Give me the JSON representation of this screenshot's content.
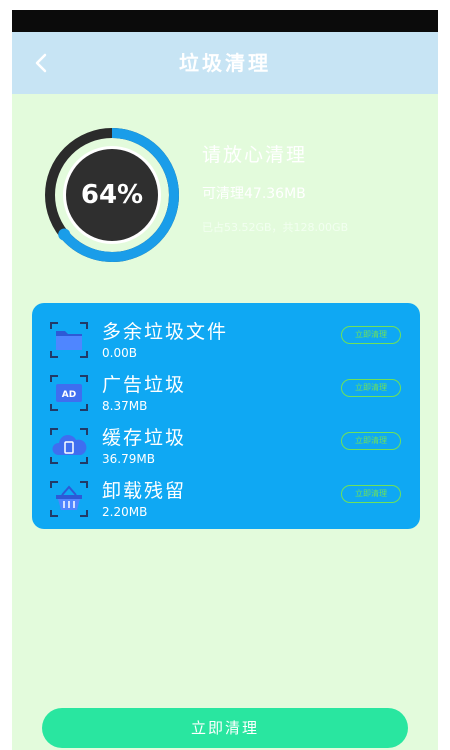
{
  "header": {
    "title": "垃圾清理",
    "back_icon": "chevron-left-icon"
  },
  "progress": {
    "percent_label": "64%",
    "value": 0.64,
    "ring_color": "#1a9de9",
    "core_color": "#2f2f2f"
  },
  "summary": {
    "headline": "请放心清理",
    "cleanable": "可清理47.36MB",
    "storage": "已占53.52GB，共128.00GB"
  },
  "categories": [
    {
      "icon": "folder-icon",
      "name": "多余垃圾文件",
      "size": "0.00B",
      "action": "立即清理"
    },
    {
      "icon": "ad-icon",
      "name": "广告垃圾",
      "size": "8.37MB",
      "action": "立即清理"
    },
    {
      "icon": "cache-icon",
      "name": "缓存垃圾",
      "size": "36.79MB",
      "action": "立即清理"
    },
    {
      "icon": "basket-icon",
      "name": "卸载残留",
      "size": "2.20MB",
      "action": "立即清理"
    }
  ],
  "cta": {
    "label": "立即清理",
    "color": "#29e6a0"
  },
  "colors": {
    "background": "#e3fbdc",
    "panel": "#0fa8f3",
    "title_bar": "#c7e4f4"
  }
}
